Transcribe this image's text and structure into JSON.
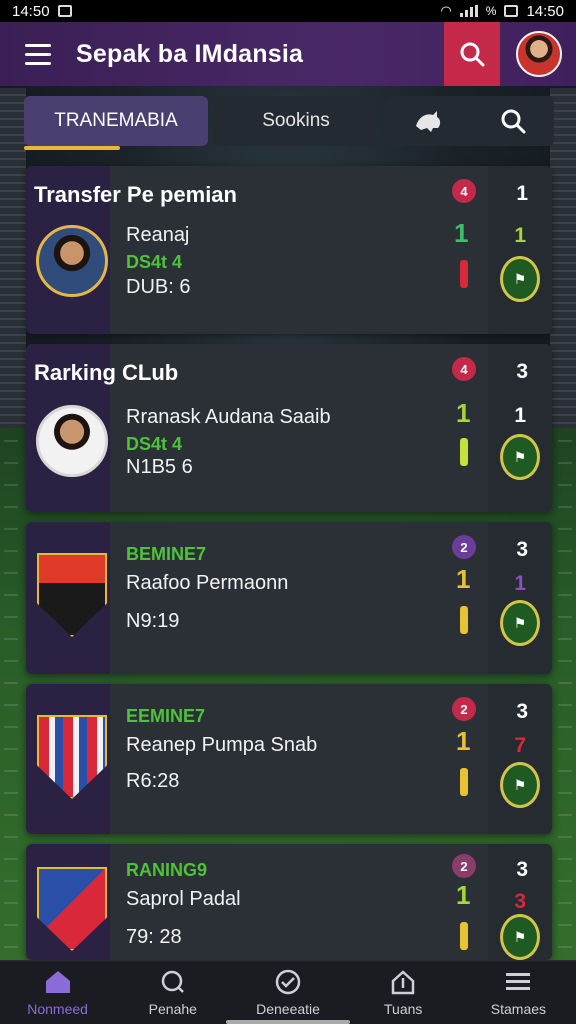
{
  "status_bar": {
    "time_left": "14:50",
    "time_right": "14:50",
    "battery": "%"
  },
  "app_bar": {
    "title": "Sepak ba IMdansia"
  },
  "tabs": [
    {
      "label": "TRANEMABIA",
      "active": true
    },
    {
      "label": "Sookins",
      "active": false
    }
  ],
  "cards": [
    {
      "title": "Transfer Pe pemian",
      "name": "Reanaj",
      "green": "DS4t 4",
      "meta": "DUB: 6",
      "badge": "4",
      "badge_color": "#c4294a",
      "top_num": "1",
      "bar_num": "1",
      "bar_num_color": "#3fbf6a",
      "mid_num": "1",
      "mid_color": "#a5d63a",
      "bar_color": "#d8283a"
    },
    {
      "title": "Rarking CLub",
      "name": "Rranask Audana Saaib",
      "green": "DS4t 4",
      "meta": "N1B5 6",
      "badge": "4",
      "badge_color": "#c4294a",
      "top_num": "3",
      "bar_num": "1",
      "bar_num_color": "#a5d63a",
      "mid_num": "1",
      "mid_color": "#ffffff",
      "bar_color": "#c4e03a"
    },
    {
      "green": "BEMINE7",
      "name": "Raafoo Permaonn",
      "meta": "N9:19",
      "badge": "2",
      "badge_color": "#6a3d9a",
      "top_num": "3",
      "bar_num": "1",
      "bar_num_color": "#e8c231",
      "mid_num": "1",
      "mid_color": "#8a4fc0",
      "bar_color": "#e8c231"
    },
    {
      "green": "EEMINE7",
      "name": "Reanep Pumpa Snab",
      "meta": "R6:28",
      "badge": "2",
      "badge_color": "#c4294a",
      "top_num": "3",
      "bar_num": "1",
      "bar_num_color": "#e8c231",
      "mid_num": "7",
      "mid_color": "#d8283a",
      "bar_color": "#e8c231"
    },
    {
      "green": "RANING9",
      "name": "Saprol Padal",
      "meta": "79: 28",
      "badge": "2",
      "badge_color": "#8a3d6a",
      "top_num": "3",
      "bar_num": "1",
      "bar_num_color": "#a5d63a",
      "mid_num": "3",
      "mid_color": "#d8283a",
      "bar_color": "#e8c231"
    }
  ],
  "bottom_nav": [
    {
      "label": "Nonmeed",
      "icon": "home-icon",
      "active": true
    },
    {
      "label": "Penahe",
      "icon": "search-icon",
      "active": false
    },
    {
      "label": "Deneeatie",
      "icon": "check-circle-icon",
      "active": false
    },
    {
      "label": "Tuans",
      "icon": "upload-icon",
      "active": false
    },
    {
      "label": "Stamaes",
      "icon": "list-icon",
      "active": false
    }
  ]
}
